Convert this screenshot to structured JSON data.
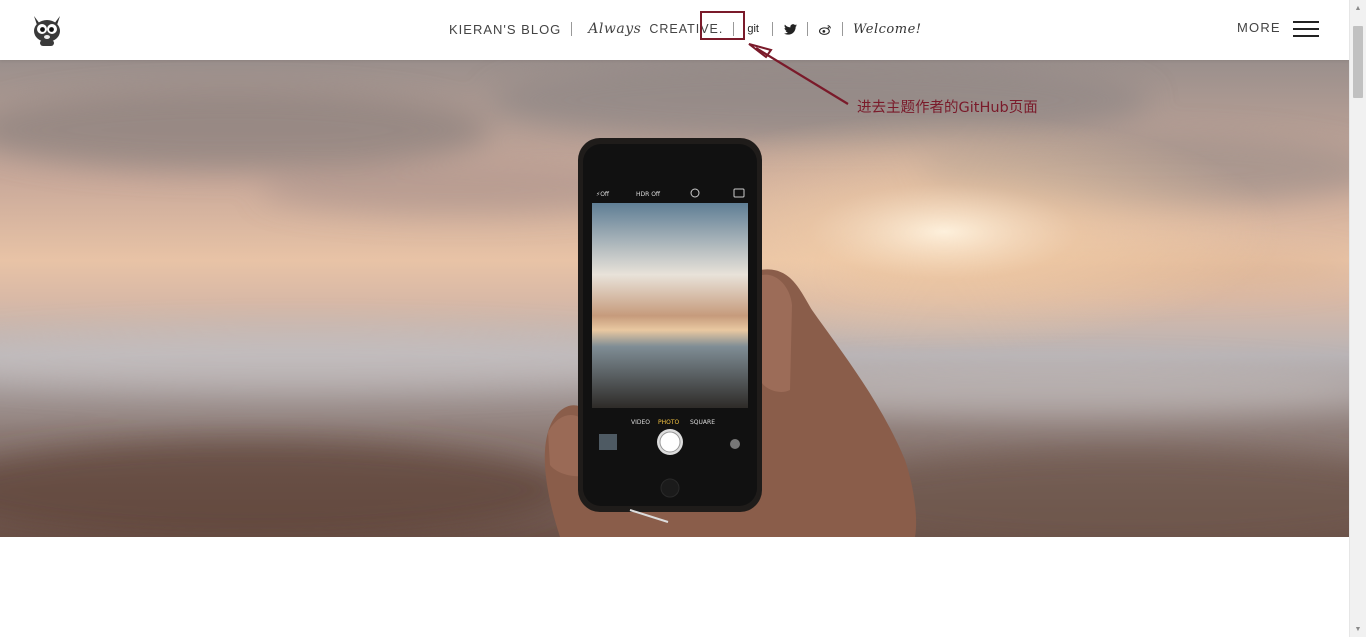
{
  "header": {
    "blog_name": "KIERAN'S BLOG",
    "tagline_italic": "Always",
    "tagline_word": "CREATIVE.",
    "git_label": "git",
    "twitter_icon": "twitter-icon",
    "weibo_icon": "weibo-icon",
    "welcome": "Welcome!",
    "more_label": "MORE",
    "logo_icon": "mascot-logo-icon",
    "menu_icon": "hamburger-menu-icon"
  },
  "annotation": {
    "text": "进去主题作者的GitHub页面",
    "color": "#7a1a2a"
  },
  "hero": {
    "phone_camera_modes": [
      "VIDEO",
      "PHOTO",
      "SQUARE"
    ],
    "phone_top_labels": [
      "⚡Off",
      "HDR Off"
    ]
  },
  "colors": {
    "accent": "#7a1a2a",
    "header_bg": "#ffffff"
  }
}
